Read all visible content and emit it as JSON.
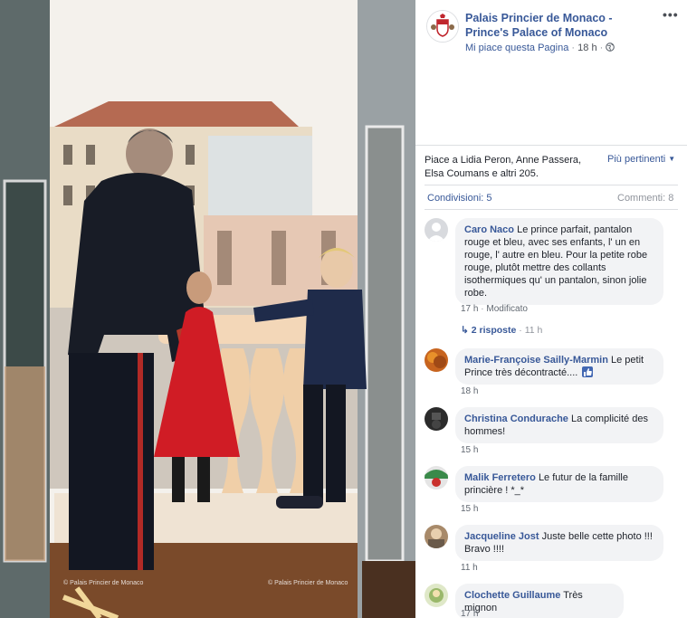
{
  "page": {
    "name": "Palais Princier de Monaco - Prince's Palace of Monaco",
    "like_label": "Mi piace questa Pagina",
    "timestamp": "18 h",
    "more_label": "•••",
    "globe_icon": "globe-icon",
    "avatar_icon": "monaco-crest-icon"
  },
  "photo": {
    "watermark_left": "© Palais Princier de Monaco",
    "watermark_right": "© Palais Princier de Monaco"
  },
  "reactions": {
    "likes_text": "Piace a Lidia Peron, Anne Passera, Elsa Coumans e altri 205.",
    "sort_label": "Più pertinenti",
    "shares": "Condivisioni: 5",
    "comments": "Commenti: 8"
  },
  "comments": [
    {
      "author": "Caro Naco",
      "text": "Le prince parfait, pantalon rouge et bleu, avec ses enfants, l' un en rouge, l' autre en bleu. Pour la petite robe rouge, plutôt mettre des collants isothermiques qu' un pantalon, sinon jolie robe.",
      "time": "17 h",
      "edited": "Modificato",
      "replies": "2 risposte",
      "replies_time": "11 h",
      "avatar_color": "#d8dade"
    },
    {
      "author": "Marie-Françoise Sailly-Marmin",
      "text": "Le petit Prince très décontracté....",
      "time": "18 h",
      "avatar_color": "#c7641f",
      "emoji_icon": "thumbs-up-emoji-icon"
    },
    {
      "author": "Christina Condurache",
      "text": "La complicité des hommes!",
      "time": "15 h",
      "avatar_color": "#2b2b2b"
    },
    {
      "author": "Malik Ferretero",
      "text": "Le futur de la famille princière ! *_*",
      "time": "15 h",
      "avatar_color": "#3a8a4a"
    },
    {
      "author": "Jacqueline Jost",
      "text": "Juste belle cette photo !!! Bravo !!!!",
      "time": "11 h",
      "avatar_color": "#a88a6a"
    },
    {
      "author": "Clochette Guillaume",
      "text": "Très mignon",
      "time": "17 h",
      "avatar_color": "#9ab86a"
    }
  ]
}
